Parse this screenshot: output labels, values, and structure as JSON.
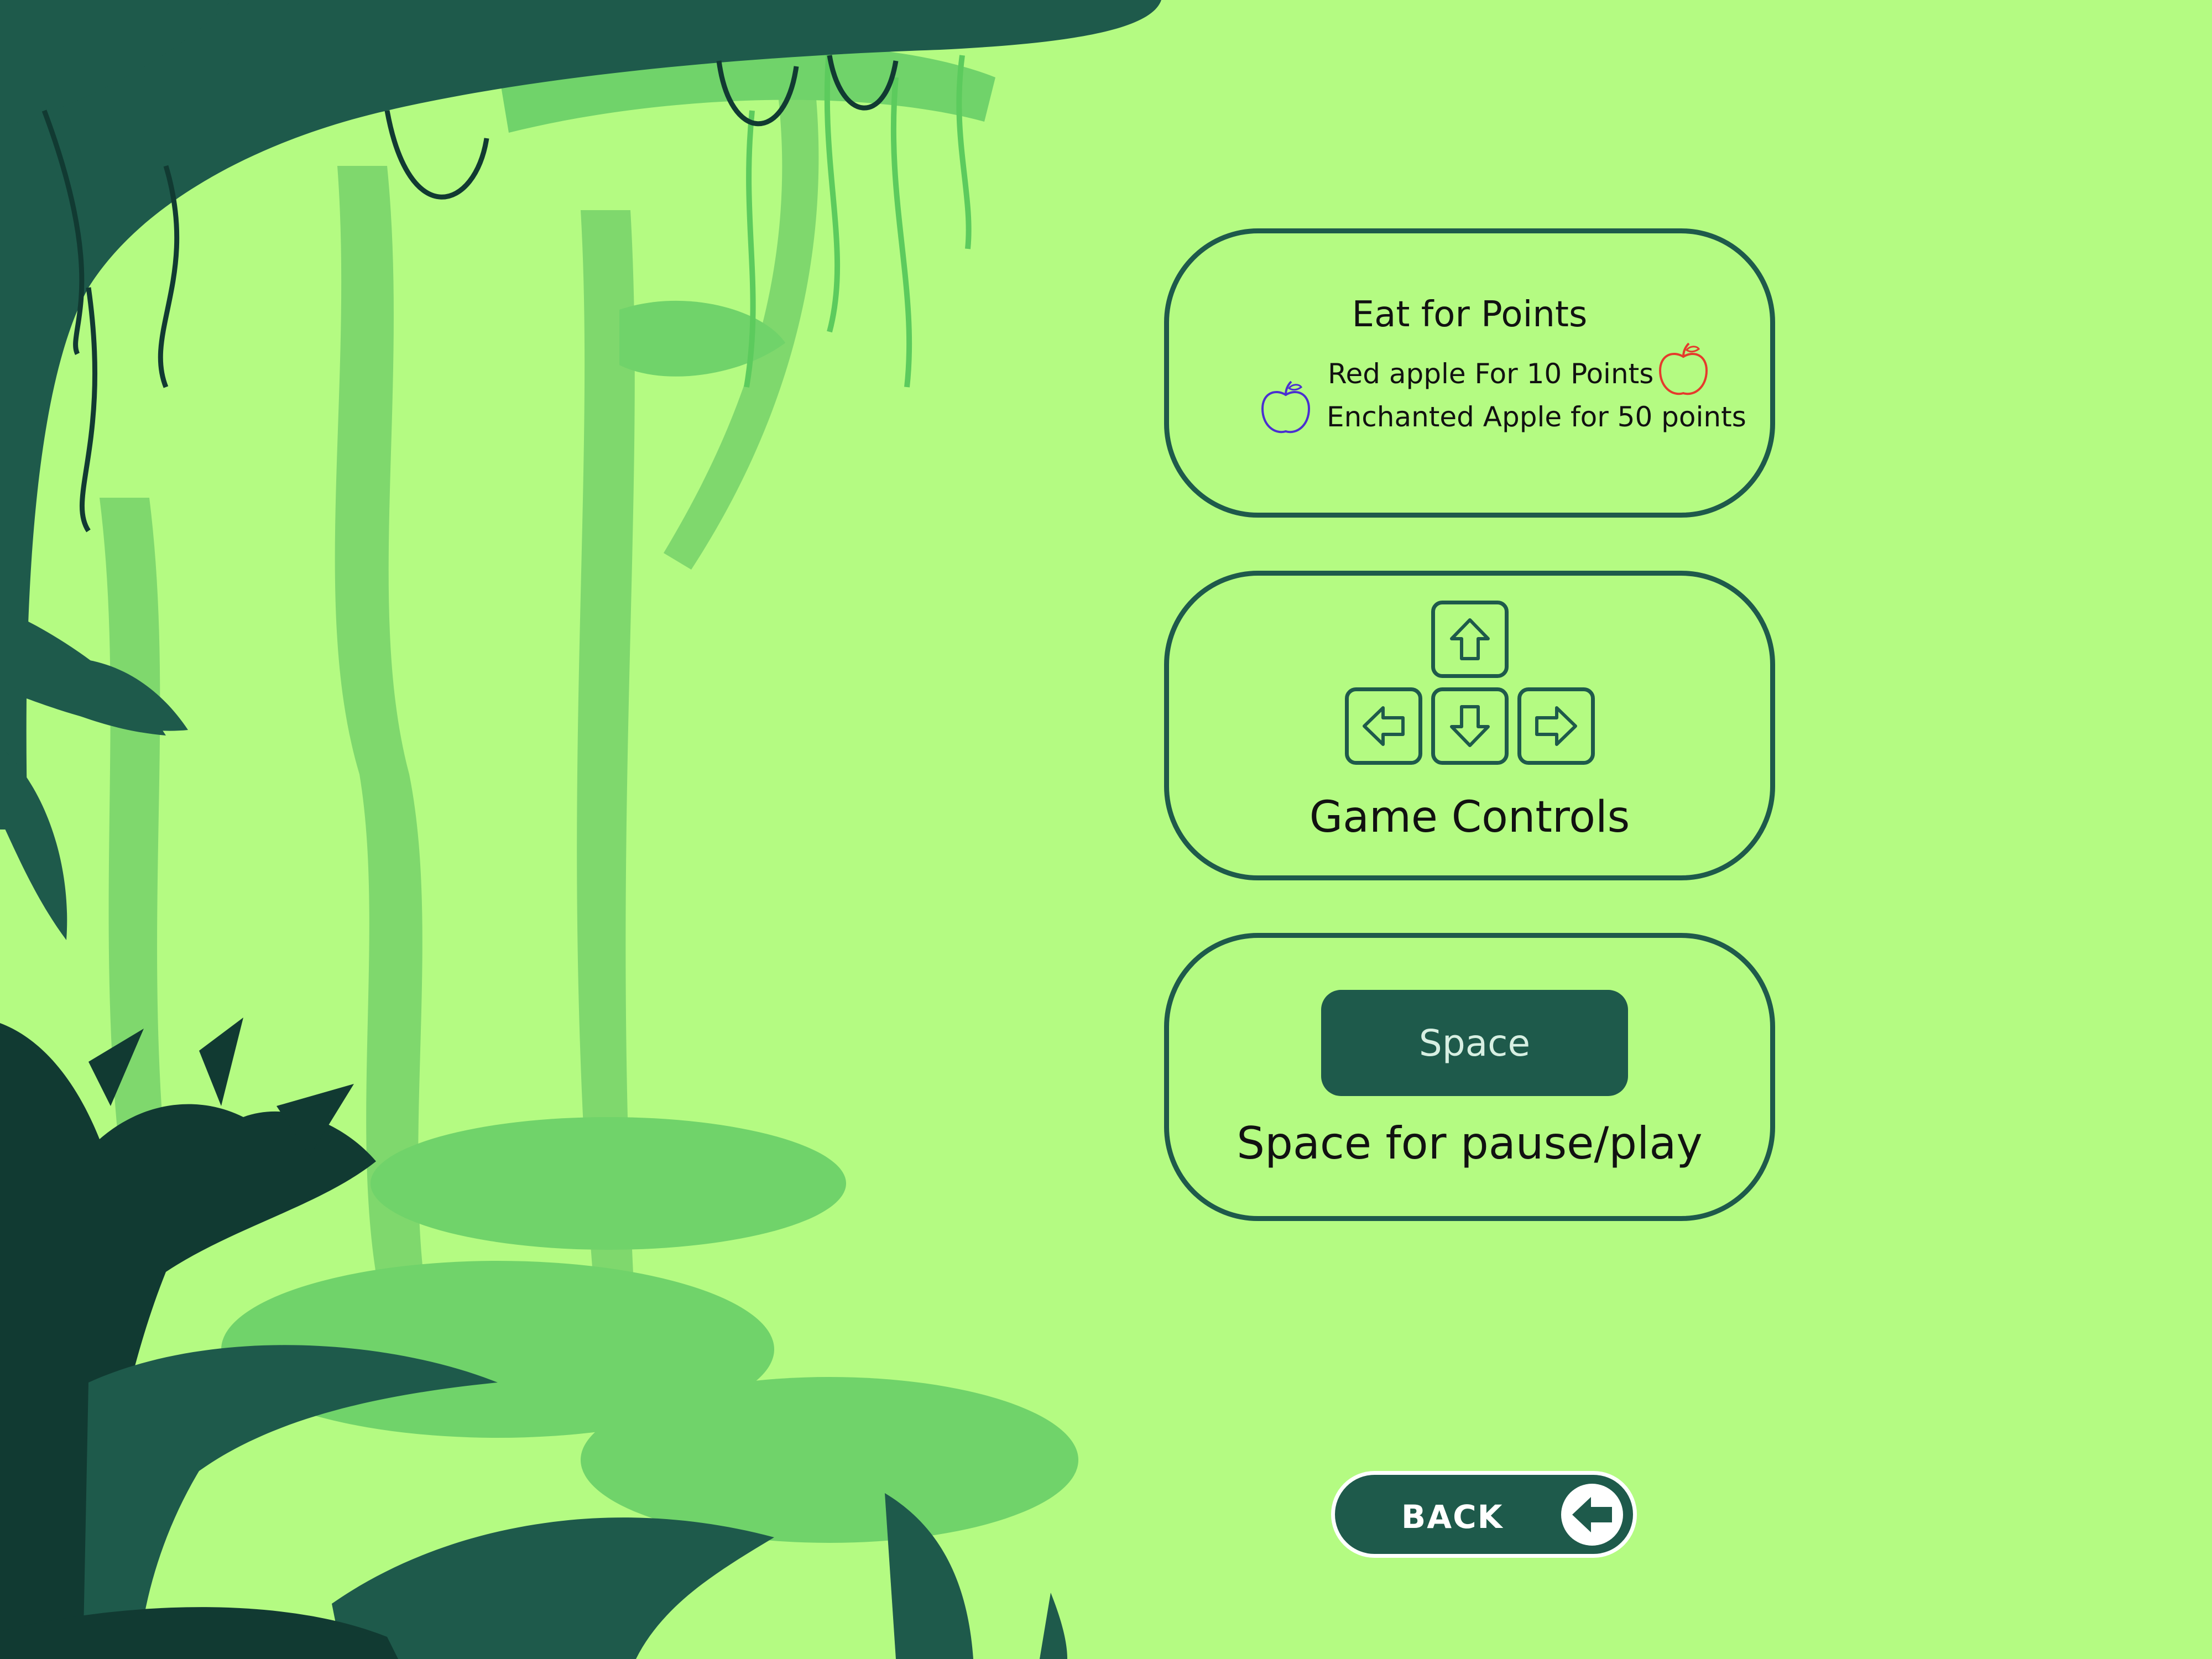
{
  "points_card": {
    "title": "Eat for Points",
    "red_apple_text": "Red apple For 10 Points",
    "enchanted_apple_text": "Enchanted Apple for 50 points",
    "red_apple_icon": "red-apple-outline",
    "enchanted_apple_icon": "blue-apple-outline",
    "red_color": "#e53a2c",
    "enchanted_color": "#4a2fd0"
  },
  "controls_card": {
    "title": "Game Controls",
    "keys": [
      "arrow-up-key",
      "arrow-left-key",
      "arrow-down-key",
      "arrow-right-key"
    ]
  },
  "pause_card": {
    "key_label": "Space",
    "description": "Space for pause/play"
  },
  "back_button": {
    "label": "BACK",
    "icon": "arrow-left-circle"
  },
  "colors": {
    "background": "#b4fb82",
    "accent": "#1e5a4b",
    "foliage_light": "#70d36a",
    "foliage_dark": "#113a32"
  }
}
